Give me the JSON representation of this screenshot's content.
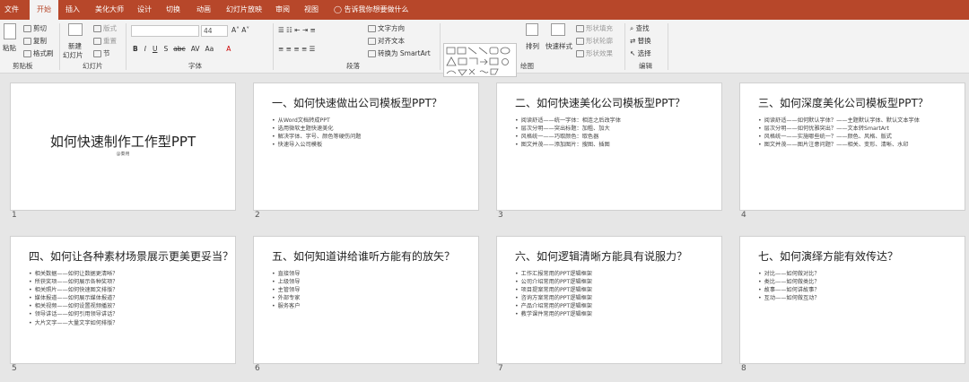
{
  "menu": {
    "tabs": [
      "文件",
      "开始",
      "插入",
      "美化大师",
      "设计",
      "切换",
      "动画",
      "幻灯片放映",
      "审阅",
      "视图"
    ],
    "tell_me": "告诉我你想要做什么"
  },
  "ribbon": {
    "clipboard": {
      "paste": "粘贴",
      "cut": "剪切",
      "copy": "复制",
      "format_painter": "格式刷",
      "label": "剪贴板"
    },
    "slides": {
      "new_slide": "新建",
      "new_slide_2": "幻灯片",
      "layout": "版式",
      "reset": "重置",
      "section": "节",
      "label": "幻灯片"
    },
    "font": {
      "size": "44",
      "label": "字体",
      "buttons": [
        "B",
        "I",
        "U",
        "S",
        "abc",
        "AV",
        "Aa",
        "A"
      ]
    },
    "paragraph": {
      "text_direction": "文字方向",
      "align_text": "对齐文本",
      "smartart": "转换为 SmartArt",
      "label": "段落"
    },
    "drawing": {
      "arrange": "排列",
      "quick_styles": "快速样式",
      "shape_fill": "形状填充",
      "shape_outline": "形状轮廓",
      "shape_effects": "形状效果",
      "label": "绘图"
    },
    "editing": {
      "find": "查找",
      "replace": "替换",
      "select": "选择",
      "label": "编辑"
    }
  },
  "slides": [
    {
      "num": "1",
      "cover": true,
      "title": "如何快速制作工作型PPT",
      "subtitle": "@秦用"
    },
    {
      "num": "2",
      "title": "一、如何快速做出公司模板型PPT？",
      "bullets": [
        "从Word文档转成PPT",
        "选用微软主题快速美化",
        "解决字体、字号、颜色等硬伤问题",
        "快速导入公司模板"
      ]
    },
    {
      "num": "3",
      "title": "二、如何快速美化公司模板型PPT？",
      "bullets": [
        "阅读舒适——统一字体：相连之后改字体",
        "层次分明——突出标题：加粗、加大",
        "风格统一——巧取颜色：取色器",
        "图文并茂——添加图片：搜图、插图"
      ]
    },
    {
      "num": "4",
      "title": "三、如何深度美化公司模板型PPT？",
      "bullets": [
        "阅读舒适——如何默认字体？——主题默认字体、默认文本字体",
        "层次分明——如何优雅突出？——文本转SmartArt",
        "风格统一——实施哪些统一？——颜色、风格、版式",
        "图文并茂——图片注意问题？——相关、变形、清晰、水印"
      ]
    },
    {
      "num": "5",
      "title": "四、如何让各种素材场景展示更美更妥当？",
      "bullets": [
        "相关数据——如何让数据更清晰？",
        "所获奖项——如何展示各种奖项？",
        "相关照片——如何快速图文排版？",
        "媒体报道——如何展示媒体报道？",
        "相关视频——如何设置视频播放？",
        "领导讲话——如何引用领导讲话？",
        "大片文字——大量文字如何排版？"
      ]
    },
    {
      "num": "6",
      "title": "五、如何知道讲给谁听方能有的放矢？",
      "bullets": [
        "直接领导",
        "上级领导",
        "主管领导",
        "外部专家",
        "服务客户"
      ]
    },
    {
      "num": "7",
      "title": "六、如何逻辑清晰方能具有说服力？",
      "bullets": [
        "工作汇报常用的PPT逻辑框架",
        "公司介绍常用的PPT逻辑框架",
        "项目提案常用的PPT逻辑框架",
        "咨询方案常用的PPT逻辑框架",
        "产品介绍常用的PPT逻辑框架",
        "教学课件常用的PPT逻辑框架"
      ]
    },
    {
      "num": "8",
      "title": "七、如何演绎方能有效传达？",
      "bullets": [
        "对比——如何做对比？",
        "类比——如何做类比？",
        "故事——如何讲故事？",
        "互动——如何做互动？"
      ]
    }
  ]
}
